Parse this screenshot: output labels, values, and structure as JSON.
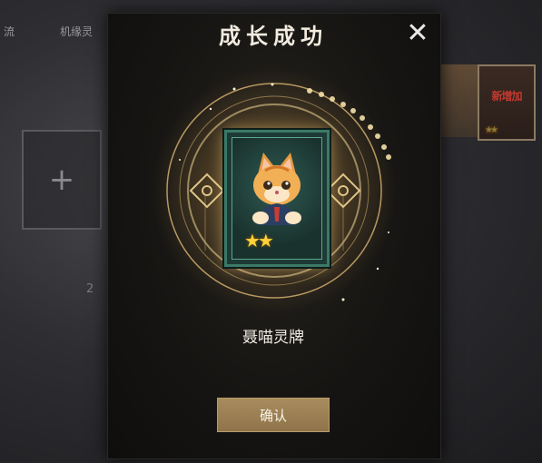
{
  "background": {
    "tab_left": "流",
    "tab_main": "机缘灵",
    "slot_plus": "+",
    "slot_number": "2",
    "red_card_text": "新增加",
    "red_card_stars": "★★"
  },
  "modal": {
    "title": "成长成功",
    "close_label": "✕",
    "card_name": "聂喵灵牌",
    "card_stars": "★★",
    "confirm_label": "确认"
  },
  "colors": {
    "gold": "#e8c27a",
    "button": "#9a7e52",
    "card_frame": "#3a7a66",
    "star": "#ffd23a"
  },
  "icons": {
    "close": "close-icon",
    "add": "plus-icon",
    "star": "star-icon"
  }
}
